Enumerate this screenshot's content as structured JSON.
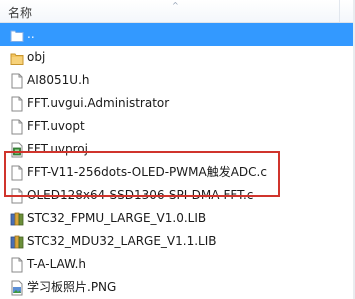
{
  "header": {
    "name_column": "名称",
    "sort_indicator": "^"
  },
  "files": [
    {
      "name": "..",
      "icon": "up-folder-icon",
      "selected": true
    },
    {
      "name": "obj",
      "icon": "folder-icon",
      "selected": false
    },
    {
      "name": "AI8051U.h",
      "icon": "header-file-icon",
      "selected": false
    },
    {
      "name": "FFT.uvgui.Administrator",
      "icon": "document-icon",
      "selected": false
    },
    {
      "name": "FFT.uvopt",
      "icon": "document-icon",
      "selected": false
    },
    {
      "name": "FFT.uvproj",
      "icon": "project-file-icon",
      "selected": false
    },
    {
      "name": "FFT-V11-256dots-OLED-PWMA触发ADC.c",
      "icon": "c-source-file-icon",
      "selected": false,
      "highlighted": true
    },
    {
      "name": "OLED128x64-SSD1306-SPI-DMA-FFT.c",
      "icon": "c-source-file-icon",
      "selected": false,
      "highlighted": true
    },
    {
      "name": "STC32_FPMU_LARGE_V1.0.LIB",
      "icon": "library-file-icon",
      "selected": false
    },
    {
      "name": "STC32_MDU32_LARGE_V1.1.LIB",
      "icon": "library-file-icon",
      "selected": false
    },
    {
      "name": "T-A-LAW.h",
      "icon": "header-file-icon",
      "selected": false
    },
    {
      "name": "学习板照片.PNG",
      "icon": "image-file-icon",
      "selected": false
    }
  ],
  "colors": {
    "selection": "#3399ff",
    "highlight_border": "#d0342c",
    "folder": "#e8b64a"
  }
}
